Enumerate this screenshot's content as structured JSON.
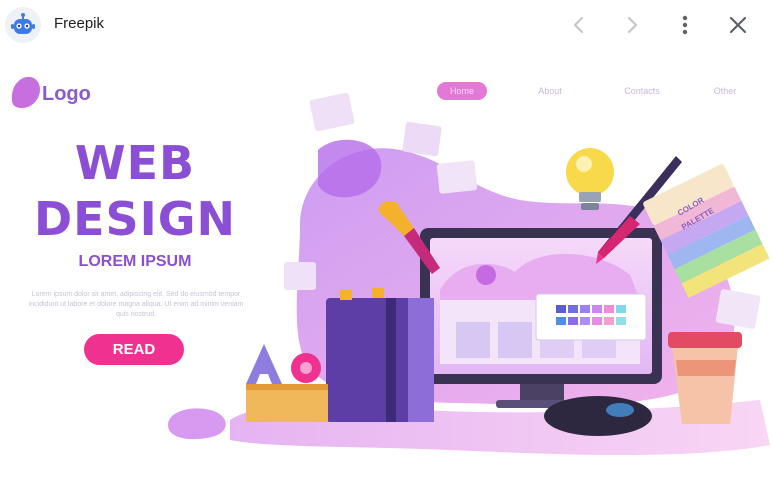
{
  "topbar": {
    "title": "Freepik",
    "app_icon": "robot-icon",
    "back_icon": "chevron-left-icon",
    "forward_icon": "chevron-right-icon",
    "menu_icon": "more-vert-icon",
    "close_icon": "close-icon",
    "colors": {
      "icon_blue": "#3f7be8",
      "icon_gray": "#5f6368",
      "disabled_gray": "#c4c7cc"
    }
  },
  "image": {
    "logo_text": "Logo",
    "nav_items": [
      "Home",
      "About",
      "Contacts",
      "Other"
    ],
    "title_line1": "WEB",
    "title_line2": "DESIGN",
    "subtitle": "LOREM IPSUM",
    "body_text": "Lorem ipsum dolor sit amet, adipiscing elit. Sed do eiusmod tempor incididunt ut labore et dolore magna aliqua. Ut enim ad minim veniam quis nostrud.",
    "button_label": "READ",
    "palette_line1": "COLOR",
    "palette_line2": "PALETTE",
    "colors": {
      "purple": "#8b4fd6",
      "pink": "#f0318f",
      "lavender": "#d9b6f2"
    }
  }
}
